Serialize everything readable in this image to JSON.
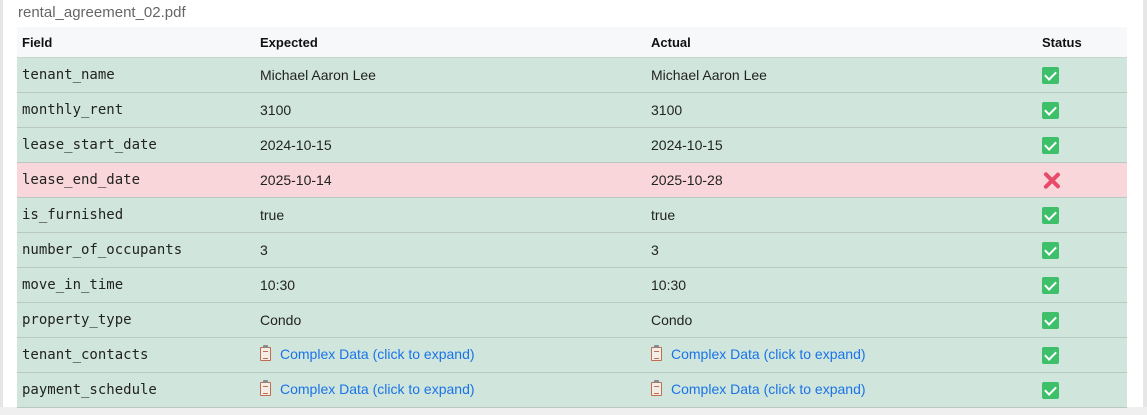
{
  "dialog": {
    "title": "rental_agreement_02.pdf"
  },
  "columns": {
    "field": "Field",
    "expected": "Expected",
    "actual": "Actual",
    "status": "Status"
  },
  "rows": [
    {
      "field": "tenant_name",
      "expected": "Michael Aaron Lee",
      "actual": "Michael Aaron Lee",
      "status": "pass"
    },
    {
      "field": "monthly_rent",
      "expected": "3100",
      "actual": "3100",
      "status": "pass"
    },
    {
      "field": "lease_start_date",
      "expected": "2024-10-15",
      "actual": "2024-10-15",
      "status": "pass"
    },
    {
      "field": "lease_end_date",
      "expected": "2025-10-14",
      "actual": "2025-10-28",
      "status": "fail"
    },
    {
      "field": "is_furnished",
      "expected": "true",
      "actual": "true",
      "status": "pass"
    },
    {
      "field": "number_of_occupants",
      "expected": "3",
      "actual": "3",
      "status": "pass"
    },
    {
      "field": "move_in_time",
      "expected": "10:30",
      "actual": "10:30",
      "status": "pass"
    },
    {
      "field": "property_type",
      "expected": "Condo",
      "actual": "Condo",
      "status": "pass"
    },
    {
      "field": "tenant_contacts",
      "expected": "Complex Data (click to expand)",
      "actual": "Complex Data (click to expand)",
      "status": "pass"
    },
    {
      "field": "payment_schedule",
      "expected": "Complex Data (click to expand)",
      "actual": "Complex Data (click to expand)",
      "status": "pass"
    }
  ],
  "complex_rows": [
    8,
    9
  ],
  "colors": {
    "pass_row": "#d0e6dc",
    "fail_row": "#f8d6da",
    "field_text": "#d1306e",
    "link": "#1a73e8",
    "pass_icon": "#3ebf6a",
    "fail_icon": "#e84a6a"
  },
  "icons": {
    "pass": "check-mark-icon",
    "fail": "cross-mark-icon",
    "complex": "clipboard-icon"
  }
}
